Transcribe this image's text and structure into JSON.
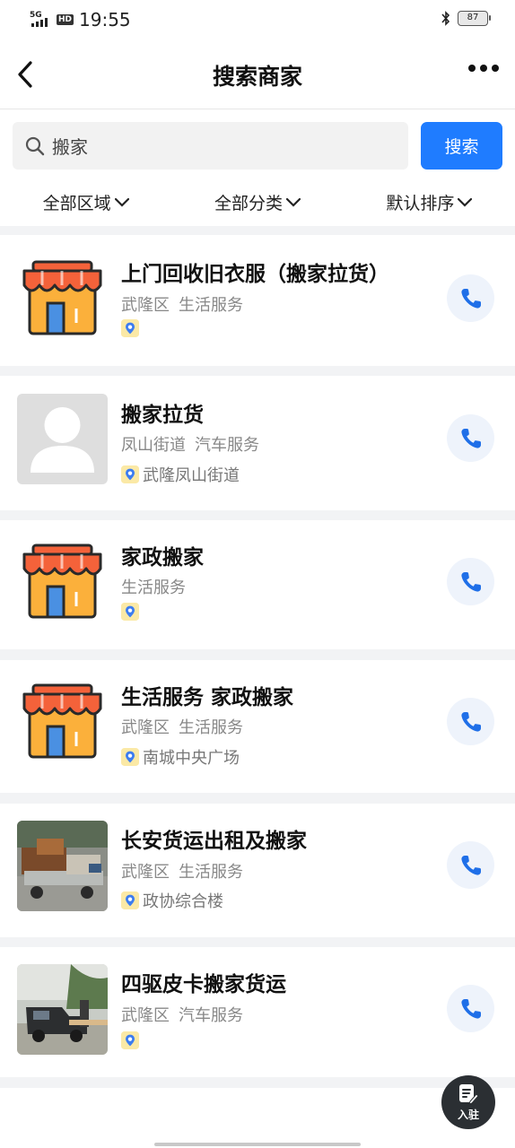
{
  "status_bar": {
    "network": "5G",
    "hd": "HD",
    "time": "19:55",
    "battery": "87"
  },
  "header": {
    "title": "搜索商家"
  },
  "search": {
    "value": "搬家",
    "button_label": "搜索"
  },
  "filters": [
    {
      "label": "全部区域"
    },
    {
      "label": "全部分类"
    },
    {
      "label": "默认排序"
    }
  ],
  "merchants": [
    {
      "name": "上门回收旧衣服（搬家拉货）",
      "district": "武隆区",
      "category": "生活服务",
      "location": "",
      "thumb": "store-icon"
    },
    {
      "name": "搬家拉货",
      "district": "凤山街道",
      "category": "汽车服务",
      "location": "武隆凤山街道",
      "thumb": "avatar-placeholder"
    },
    {
      "name": "家政搬家",
      "district": "",
      "category": "生活服务",
      "location": "",
      "thumb": "store-icon"
    },
    {
      "name": "生活服务 家政搬家",
      "district": "武隆区",
      "category": "生活服务",
      "location": "南城中央广场",
      "thumb": "store-icon"
    },
    {
      "name": "长安货运出租及搬家",
      "district": "武隆区",
      "category": "生活服务",
      "location": "政协综合楼",
      "thumb": "truck-photo"
    },
    {
      "name": "四驱皮卡搬家货运",
      "district": "武隆区",
      "category": "汽车服务",
      "location": "",
      "thumb": "pickup-photo"
    }
  ],
  "fab": {
    "label": "入驻"
  },
  "colors": {
    "accent": "#1f7cff",
    "store_awning": "#f4623a",
    "store_body": "#fbb03b"
  }
}
